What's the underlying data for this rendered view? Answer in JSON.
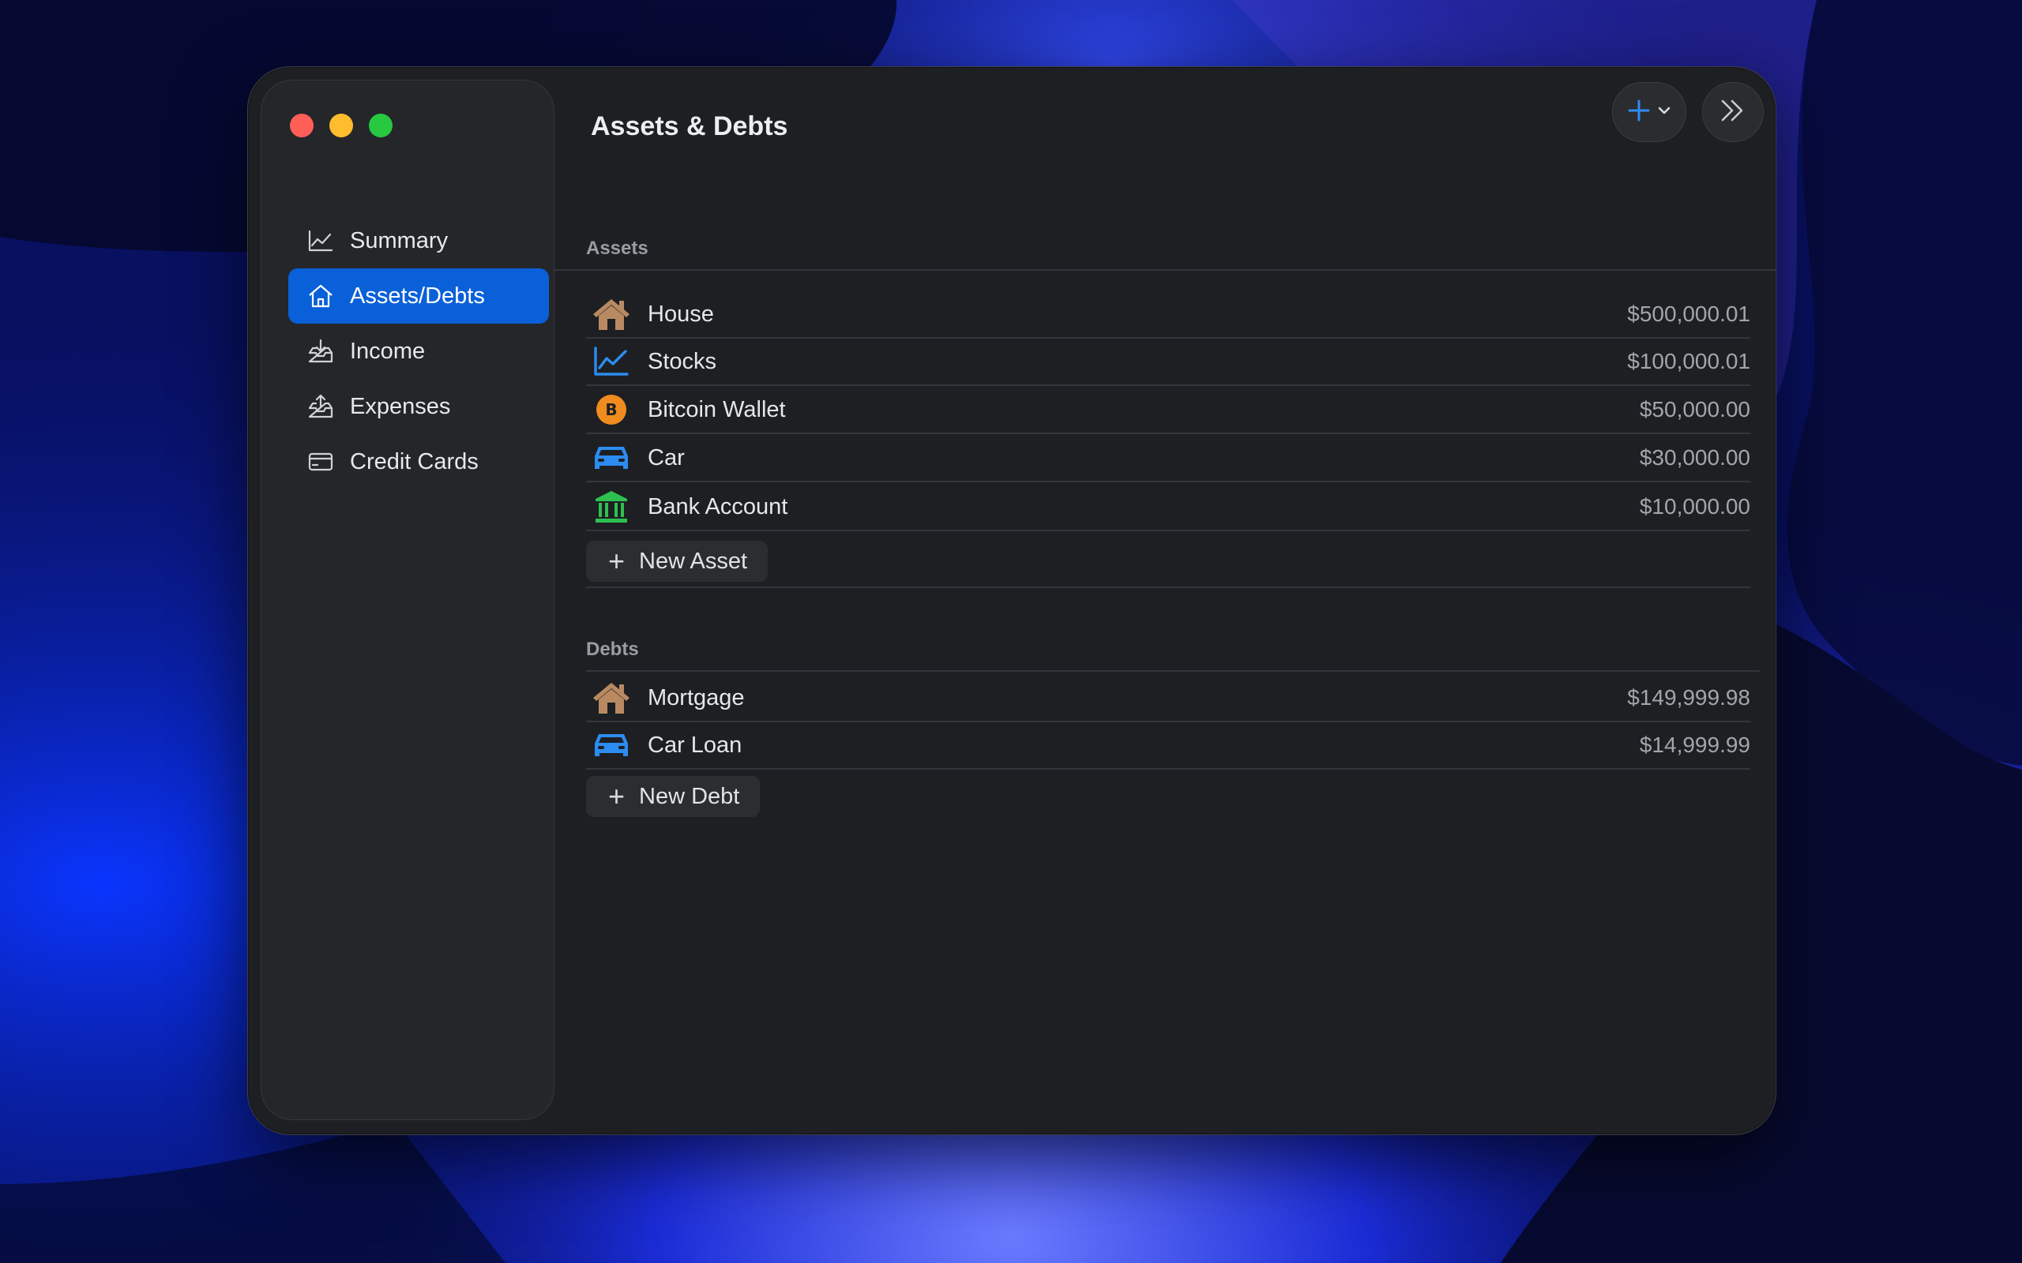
{
  "window": {
    "title": "Assets & Debts"
  },
  "sidebar": {
    "items": [
      {
        "label": "Summary",
        "icon": "chart-line-icon",
        "active": false
      },
      {
        "label": "Assets/Debts",
        "icon": "house-icon",
        "active": true
      },
      {
        "label": "Income",
        "icon": "tray-download-icon",
        "active": false
      },
      {
        "label": "Expenses",
        "icon": "tray-upload-icon",
        "active": false
      },
      {
        "label": "Credit Cards",
        "icon": "credit-card-icon",
        "active": false
      }
    ]
  },
  "toolbar": {
    "add_icon": "plus-icon",
    "add_menu_icon": "chevron-down-icon",
    "expand_icon": "chevrons-right-icon"
  },
  "assets": {
    "heading": "Assets",
    "items": [
      {
        "label": "House",
        "amount": "$500,000.01",
        "icon": "house-icon",
        "color": "#b98a62"
      },
      {
        "label": "Stocks",
        "amount": "$100,000.01",
        "icon": "chart-line-icon",
        "color": "#2d8cf0"
      },
      {
        "label": "Bitcoin Wallet",
        "amount": "$50,000.00",
        "icon": "bitcoin-icon",
        "color": "#f08c1e"
      },
      {
        "label": "Car",
        "amount": "$30,000.00",
        "icon": "car-icon",
        "color": "#2d8cf0"
      },
      {
        "label": "Bank Account",
        "amount": "$10,000.00",
        "icon": "bank-icon",
        "color": "#2ec04f"
      }
    ],
    "new_label": "New Asset"
  },
  "debts": {
    "heading": "Debts",
    "items": [
      {
        "label": "Mortgage",
        "amount": "$149,999.98",
        "icon": "house-icon",
        "color": "#b98a62"
      },
      {
        "label": "Car Loan",
        "amount": "$14,999.99",
        "icon": "car-icon",
        "color": "#2d8cf0"
      }
    ],
    "new_label": "New Debt"
  },
  "colors": {
    "accent": "#0a60d9",
    "window_bg": "#1d1f23",
    "sidebar_bg": "#24262a"
  }
}
